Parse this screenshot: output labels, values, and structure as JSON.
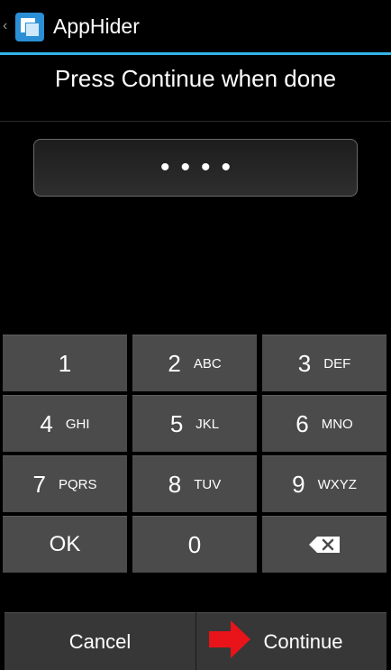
{
  "app": {
    "title": "AppHider",
    "icon": "app-window-icon",
    "up_icon": "‹"
  },
  "header": {
    "message": "Press Continue when done"
  },
  "pin": {
    "masked": "••••"
  },
  "keypad": {
    "keys": [
      {
        "num": "1",
        "letters": ""
      },
      {
        "num": "2",
        "letters": "ABC"
      },
      {
        "num": "3",
        "letters": "DEF"
      },
      {
        "num": "4",
        "letters": "GHI"
      },
      {
        "num": "5",
        "letters": "JKL"
      },
      {
        "num": "6",
        "letters": "MNO"
      },
      {
        "num": "7",
        "letters": "PQRS"
      },
      {
        "num": "8",
        "letters": "TUV"
      },
      {
        "num": "9",
        "letters": "WXYZ"
      },
      {
        "num": "OK",
        "letters": ""
      },
      {
        "num": "0",
        "letters": ""
      },
      {
        "num": "",
        "letters": "",
        "icon": "backspace-icon"
      }
    ]
  },
  "buttons": {
    "cancel": "Cancel",
    "continue": "Continue"
  },
  "colors": {
    "accent": "#33b5e5",
    "key_bg": "#4b4b4b",
    "arrow": "#e8141a"
  }
}
